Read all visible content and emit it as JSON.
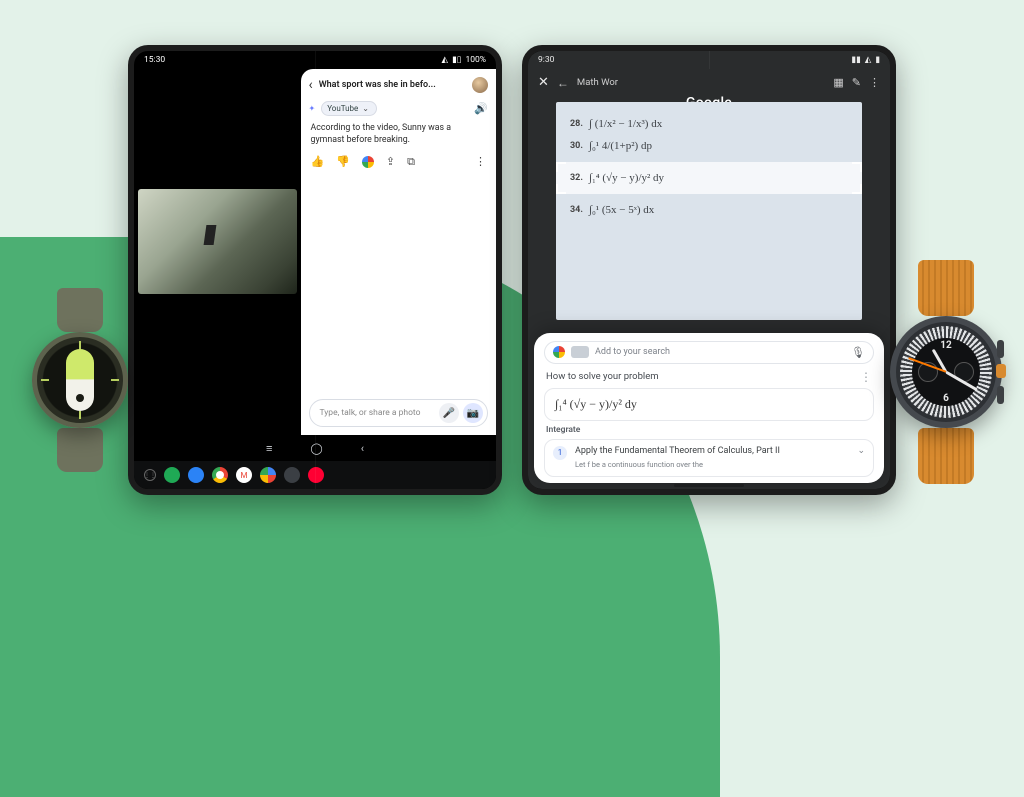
{
  "left_fold": {
    "status": {
      "time": "15:30",
      "battery": "100%"
    },
    "chat": {
      "title": "What sport was she in befo...",
      "chip_label": "YouTube",
      "answer": "According to the video, Sunny was a gymnast before breaking.",
      "input_placeholder": "Type, talk, or share a photo"
    }
  },
  "right_fold": {
    "status": {
      "time": "9:30"
    },
    "topbar": {
      "doc_title": "Math Wor",
      "overlay": "Google"
    },
    "problems": [
      {
        "num": "28.",
        "expr": "∫ (1/x² − 1/x³) dx"
      },
      {
        "num": "30.",
        "expr": "∫₀¹ 4/(1+p²) dp"
      },
      {
        "num": "32.",
        "expr": "∫₁⁴ (√y − y)/y² dy",
        "selected": true
      },
      {
        "num": "34.",
        "expr": "∫₀¹ (5x − 5ˣ) dx"
      }
    ],
    "sheet": {
      "search_placeholder": "Add to your search",
      "heading": "How to solve your problem",
      "integral": "∫₁⁴ (√y − y)/y² dy",
      "section_label": "Integrate",
      "step_number": "1",
      "step_title": "Apply the Fundamental Theorem of Calculus, Part II",
      "step_sub": "Let f be a continuous function over the"
    }
  },
  "watch_right": {
    "num12": "12",
    "num6": "6"
  }
}
